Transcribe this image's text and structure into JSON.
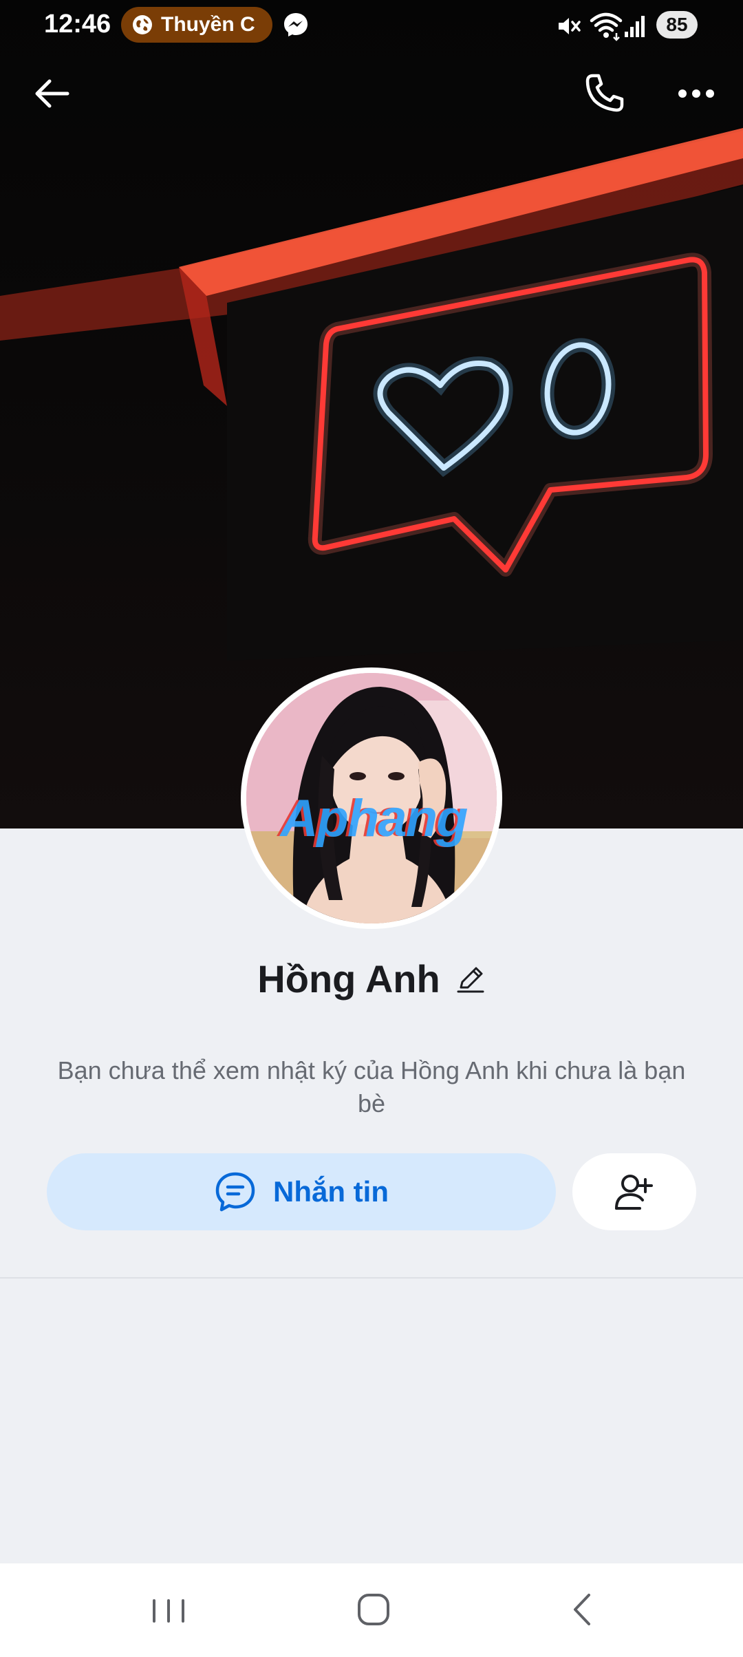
{
  "status_bar": {
    "time": "12:46",
    "notification_pill": "Thuyền C",
    "battery": "85"
  },
  "profile": {
    "name": "Hồng Anh",
    "avatar_watermark": "Aphang",
    "notice": "Bạn chưa thể xem nhật ký của Hồng Anh khi chưa là bạn bè"
  },
  "actions": {
    "message_label": "Nhắn tin"
  },
  "icons": {
    "back": "arrow-left-icon",
    "call": "phone-icon",
    "more": "more-horizontal-icon",
    "edit": "pencil-icon",
    "message": "chat-bubble-icon",
    "add_friend": "add-user-icon"
  },
  "colors": {
    "accent": "#0869d8",
    "message_button_bg": "#d6e9fd",
    "page_bg": "#eef0f4"
  }
}
